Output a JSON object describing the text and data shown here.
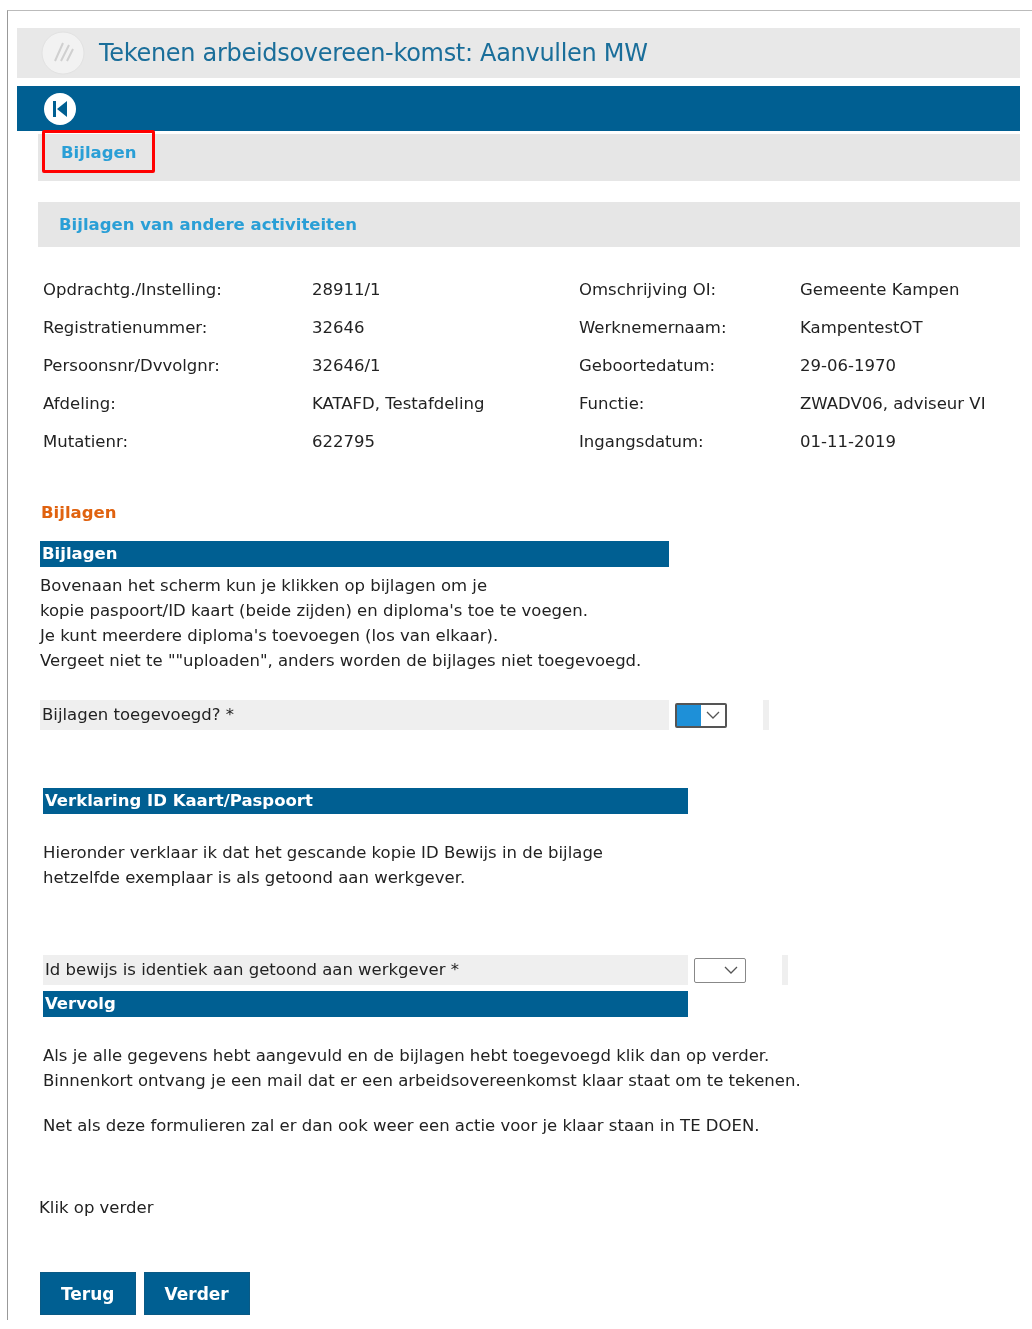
{
  "window": {
    "title": "Tekenen arbeidsovereen-komst: Aanvullen MW"
  },
  "tabs": [
    {
      "label": "Bijlagen",
      "selected": false,
      "annotated": true
    }
  ],
  "section_bar": {
    "label": "Bijlagen van andere activiteiten"
  },
  "info": [
    {
      "label": "Opdrachtg./Instelling:",
      "value": "28911/1",
      "label_2": "Omschrijving OI:",
      "value_2": "Gemeente Kampen"
    },
    {
      "label": "Registratienummer:",
      "value": "32646",
      "label_2": "Werknemernaam:",
      "value_2": "KampentestOT"
    },
    {
      "label": "Persoonsnr/Dvvolgnr:",
      "value": "32646/1",
      "label_2": "Geboortedatum:",
      "value_2": "29-06-1970"
    },
    {
      "label": "Afdeling:",
      "value": "KATAFD, Testafdeling",
      "label_2": "Functie:",
      "value_2": "ZWADV06, adviseur VI"
    },
    {
      "label": "Mutatienr:",
      "value": "622795",
      "label_2": "Ingangsdatum:",
      "value_2": "01-11-2019"
    }
  ],
  "form_title": "Bijlagen",
  "blocks": [
    {
      "kind": "header",
      "label": "Bijlagen"
    },
    {
      "kind": "text",
      "lines": [
        "Bovenaan het scherm kun je klikken op bijlagen om je",
        "kopie paspoort/ID kaart (beide zijden) en diploma's toe te voegen.",
        "Je kunt meerdere diploma's toevoegen (los van elkaar).",
        "Vergeet niet te \"\"uploaden\", anders worden de bijlages niet toegevoegd."
      ]
    },
    {
      "kind": "question",
      "label": "Bijlagen toegevoegd? *",
      "filled": true
    },
    {
      "kind": "header",
      "label": "Verklaring ID Kaart/Paspoort"
    },
    {
      "kind": "text",
      "lines": [
        "Hieronder verklaar ik dat het gescande kopie ID Bewijs in de bijlage",
        "hetzelfde exemplaar is als getoond aan werkgever."
      ]
    },
    {
      "kind": "question",
      "label": "Id bewijs is identiek aan getoond aan werkgever *",
      "filled": false
    },
    {
      "kind": "header",
      "label": "Vervolg"
    },
    {
      "kind": "text",
      "lines": [
        "Als je alle gegevens hebt aangevuld en de bijlagen hebt toegevoegd klik dan op verder.",
        "Binnenkort ontvang je een mail dat er een arbeidsovereenkomst klaar staat om te tekenen."
      ]
    },
    {
      "kind": "text",
      "lines": [
        "Net als deze formulieren zal er dan ook weer een actie voor je klaar staan in TE DOEN."
      ]
    }
  ],
  "footer_text": "Klik op verder",
  "buttons": [
    "Terug",
    "Verder"
  ]
}
